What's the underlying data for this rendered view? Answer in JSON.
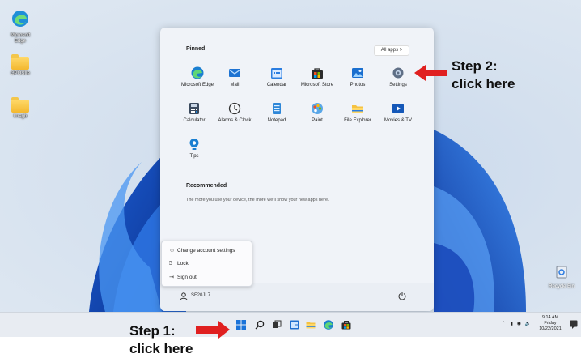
{
  "desktop": {
    "icons": [
      {
        "label": "Microsoft Edge"
      },
      {
        "label": "GPOSIIe"
      },
      {
        "label": "Imagb"
      }
    ],
    "recycle_bin": "Recycle Bin"
  },
  "start_menu": {
    "pinned_title": "Pinned",
    "all_apps_label": "All apps  >",
    "apps": [
      {
        "label": "Microsoft Edge",
        "icon": "edge-icon"
      },
      {
        "label": "Mail",
        "icon": "mail-icon"
      },
      {
        "label": "Calendar",
        "icon": "calendar-icon"
      },
      {
        "label": "Microsoft Store",
        "icon": "store-icon"
      },
      {
        "label": "Photos",
        "icon": "photos-icon"
      },
      {
        "label": "Settings",
        "icon": "gear-icon"
      },
      {
        "label": "Calculator",
        "icon": "calculator-icon"
      },
      {
        "label": "Alarms & Clock",
        "icon": "clock-icon"
      },
      {
        "label": "Notepad",
        "icon": "notepad-icon"
      },
      {
        "label": "Paint",
        "icon": "paint-icon"
      },
      {
        "label": "File Explorer",
        "icon": "folder-icon"
      },
      {
        "label": "Movies & TV",
        "icon": "play-icon"
      },
      {
        "label": "Tips",
        "icon": "tips-icon"
      }
    ],
    "recommended_title": "Recommended",
    "recommended_text": "The more you use your device, the more we'll show your new apps here.",
    "user_name": "SF20JL7"
  },
  "account_menu": {
    "items": [
      {
        "label": "Change account settings"
      },
      {
        "label": "Lock"
      },
      {
        "label": "Sign out"
      }
    ]
  },
  "taskbar": {
    "time": "9:14 AM",
    "day": "Friday",
    "date": "10/22/2021"
  },
  "annotations": {
    "step1_line1": "Step 1:",
    "step1_line2": "click here",
    "step2_line1": "Step 2:",
    "step2_line2": "click here",
    "arrow_color": "#e02020"
  },
  "colors": {
    "accent": "#0a66c8"
  }
}
